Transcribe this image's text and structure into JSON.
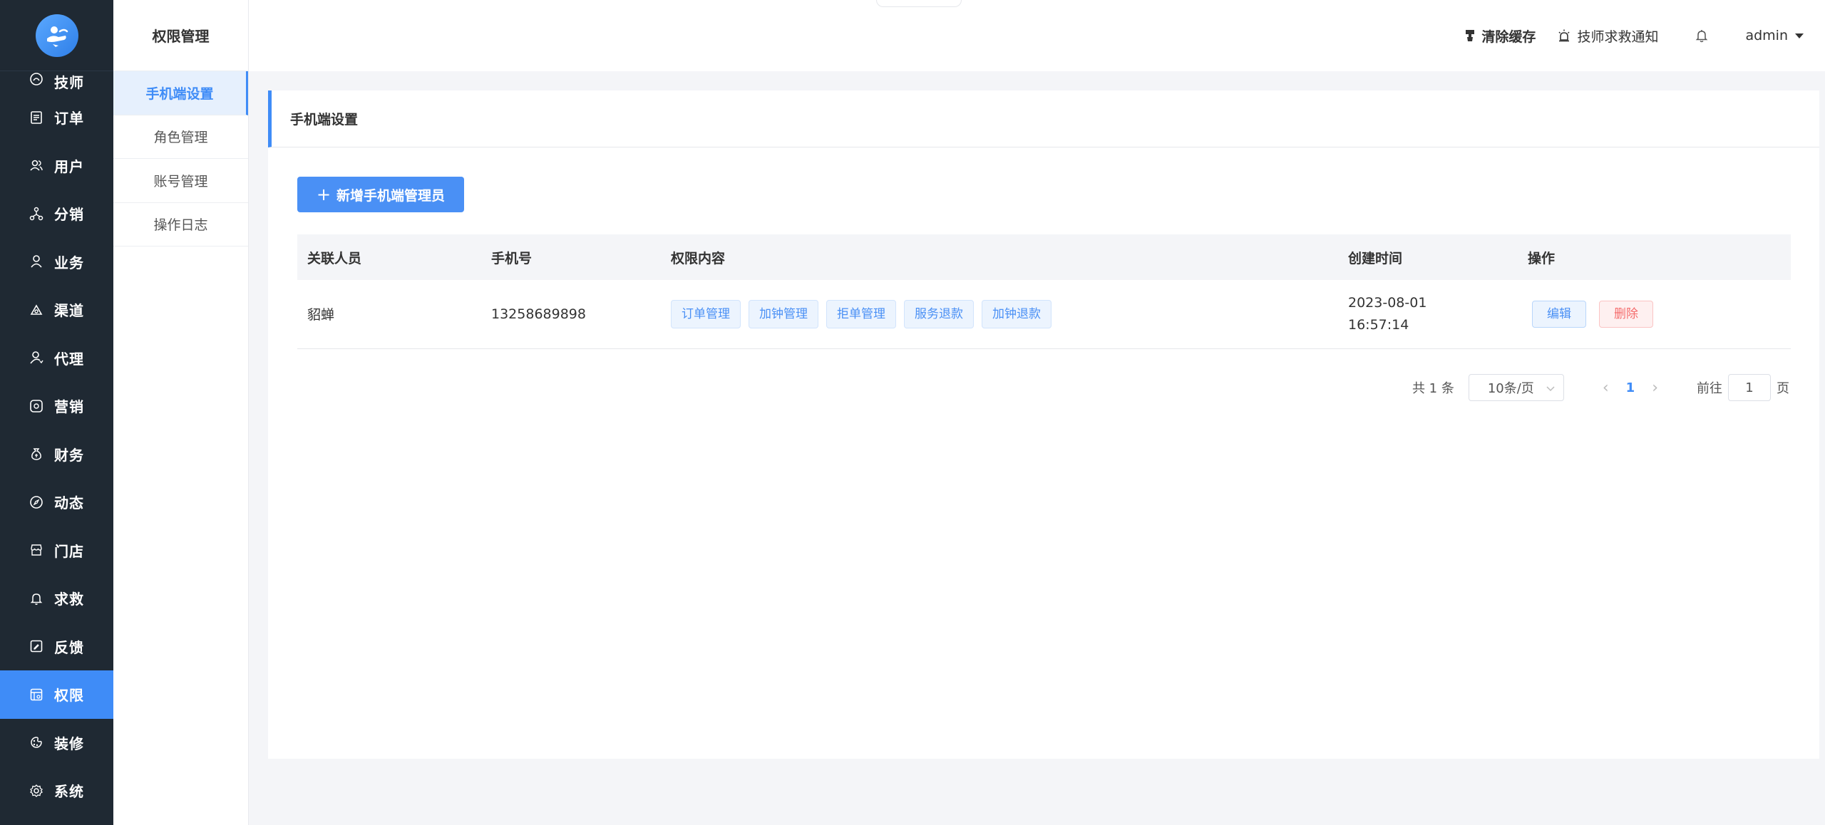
{
  "sidebar": {
    "items": [
      {
        "label": "技师",
        "icon": "technician-icon"
      },
      {
        "label": "订单",
        "icon": "order-icon"
      },
      {
        "label": "用户",
        "icon": "users-icon"
      },
      {
        "label": "分销",
        "icon": "distribution-icon"
      },
      {
        "label": "业务",
        "icon": "business-icon"
      },
      {
        "label": "渠道",
        "icon": "channel-icon"
      },
      {
        "label": "代理",
        "icon": "agent-icon"
      },
      {
        "label": "营销",
        "icon": "marketing-icon"
      },
      {
        "label": "财务",
        "icon": "finance-icon"
      },
      {
        "label": "动态",
        "icon": "compass-icon"
      },
      {
        "label": "门店",
        "icon": "store-icon"
      },
      {
        "label": "求救",
        "icon": "bell-icon"
      },
      {
        "label": "反馈",
        "icon": "feedback-icon"
      },
      {
        "label": "权限",
        "icon": "permission-icon",
        "active": true
      },
      {
        "label": "装修",
        "icon": "decor-icon"
      },
      {
        "label": "系统",
        "icon": "gear-icon"
      }
    ]
  },
  "submenu": {
    "title": "权限管理",
    "items": [
      {
        "label": "手机端设置",
        "active": true
      },
      {
        "label": "角色管理"
      },
      {
        "label": "账号管理"
      },
      {
        "label": "操作日志"
      }
    ]
  },
  "header": {
    "clear_cache": "清除缓存",
    "sos_notice": "技师求救通知",
    "user": "admin"
  },
  "card": {
    "title": "手机端设置",
    "add_button": "新增手机端管理员"
  },
  "table": {
    "columns": [
      "关联人员",
      "手机号",
      "权限内容",
      "创建时间",
      "操作"
    ],
    "rows": [
      {
        "person": "貂蝉",
        "phone": "13258689898",
        "permissions": [
          "订单管理",
          "加钟管理",
          "拒单管理",
          "服务退款",
          "加钟退款"
        ],
        "created_date": "2023-08-01",
        "created_time": "16:57:14",
        "edit": "编辑",
        "delete": "删除"
      }
    ]
  },
  "pager": {
    "total": "共 1 条",
    "page_size": "10条/页",
    "current": "1",
    "goto_label": "前往",
    "goto_value": "1",
    "page_suffix": "页"
  },
  "colors": {
    "accent": "#3f8cf7",
    "sidebar_bg": "#1f2933",
    "danger": "#f56c6c"
  }
}
